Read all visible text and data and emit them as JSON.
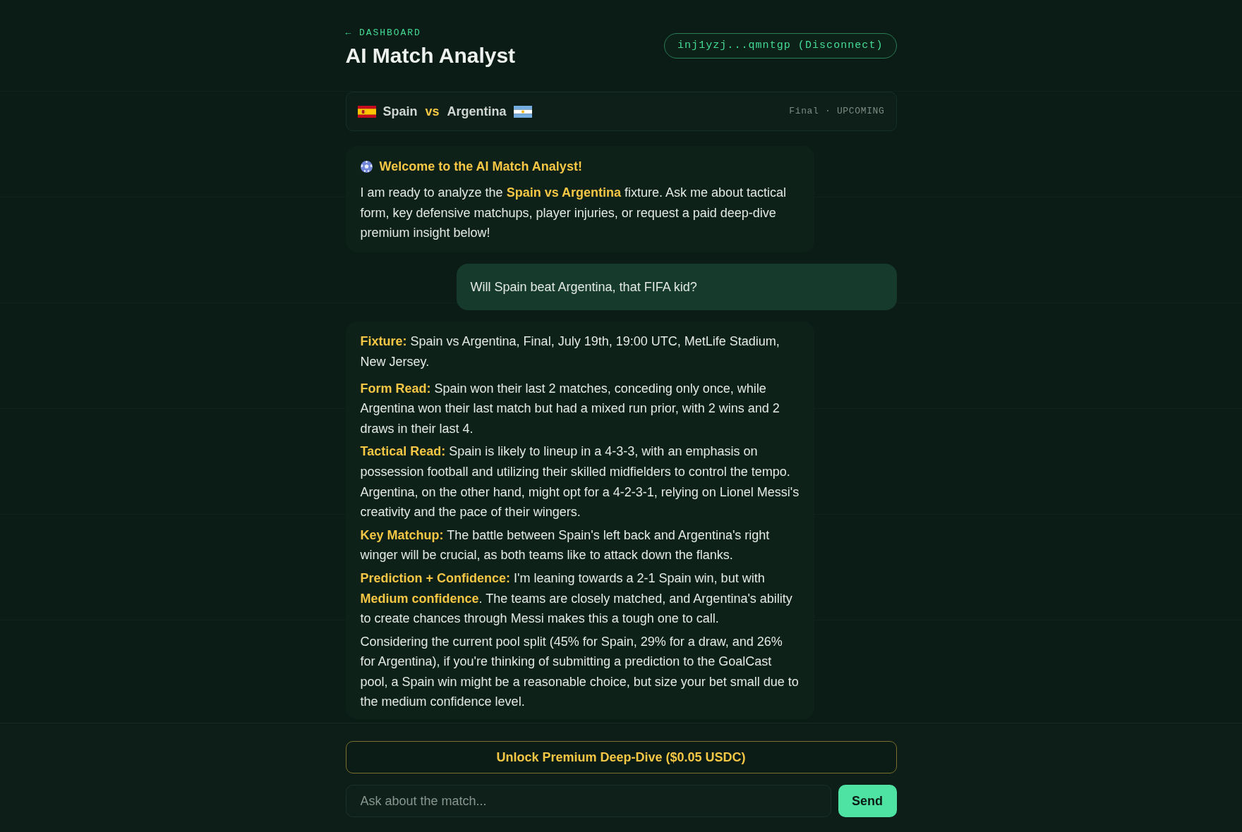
{
  "header": {
    "back_link": "← DASHBOARD",
    "title": "AI Match Analyst",
    "wallet_button": "inj1yzj...qmntgp (Disconnect)"
  },
  "match": {
    "home_team": "Spain",
    "versus": "vs",
    "away_team": "Argentina",
    "status": "Final · UPCOMING"
  },
  "messages": [
    {
      "kind": "assistant",
      "title": "Welcome to the AI Match Analyst!",
      "paragraphs": [
        "I am ready to analyze the **Spain vs Argentina** fixture. Ask me about tactical form, key defensive matchups, player injuries, or request a paid deep-dive premium insight below!"
      ]
    },
    {
      "kind": "user",
      "text": "Will Spain beat Argentina, that FIFA kid?"
    },
    {
      "kind": "assistant",
      "paragraphs": [
        "**Fixture:** Spain vs Argentina, Final, July 19th, 19:00 UTC, MetLife Stadium, New Jersey.",
        "**Form Read:** Spain won their last 2 matches, conceding only once, while Argentina won their last match but had a mixed run prior, with 2 wins and 2 draws in their last 4.",
        "**Tactical Read:** Spain is likely to lineup in a 4-3-3, with an emphasis on possession football and utilizing their skilled midfielders to control the tempo. Argentina, on the other hand, might opt for a 4-2-3-1, relying on Lionel Messi's creativity and the pace of their wingers.",
        "**Key Matchup:** The battle between Spain's left back and Argentina's right winger will be crucial, as both teams like to attack down the flanks.",
        "**Prediction + Confidence:** I'm leaning towards a 2-1 Spain win, but with **Medium confidence**. The teams are closely matched, and Argentina's ability to create chances through Messi makes this a tough one to call.",
        "Considering the current pool split (45% for Spain, 29% for a draw, and 26% for Argentina), if you're thinking of submitting a prediction to the GoalCast pool, a Spain win might be a reasonable choice, but size your bet small due to the medium confidence level."
      ]
    }
  ],
  "premium_button": "Unlock Premium Deep-Dive ($0.05 USDC)",
  "composer": {
    "placeholder": "Ask about the match...",
    "send_button": "Send"
  }
}
